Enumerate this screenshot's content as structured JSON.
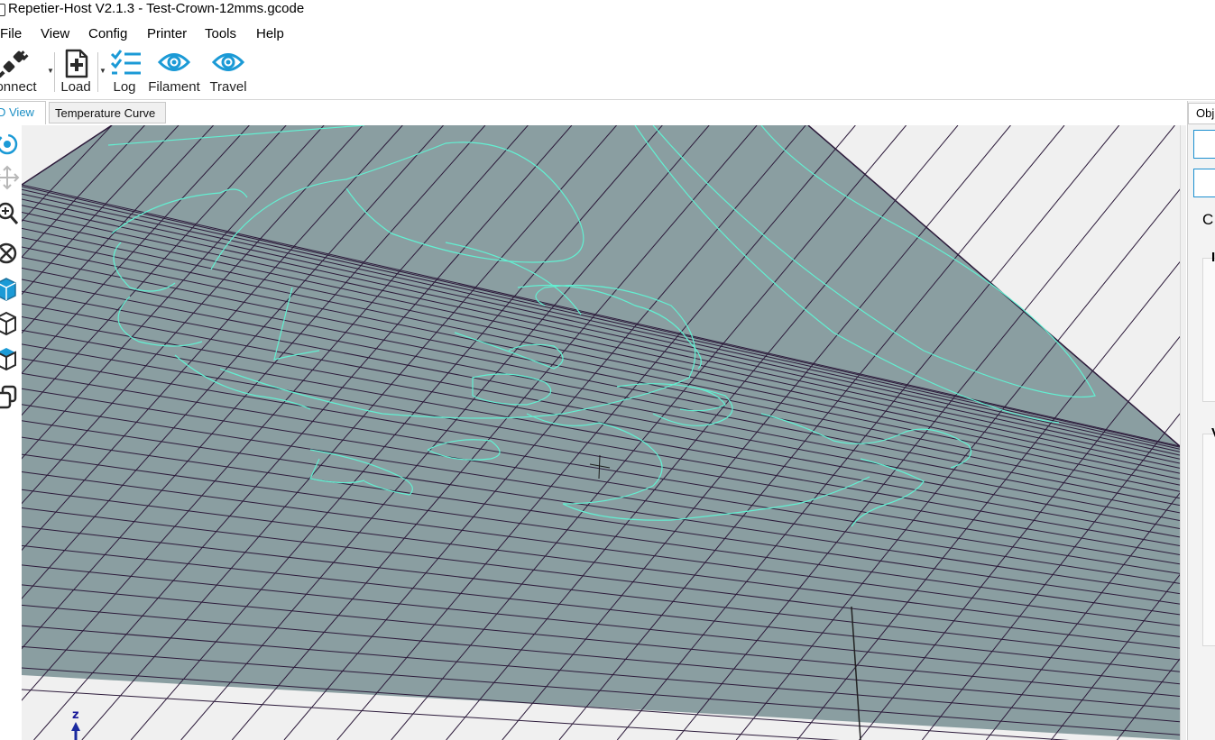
{
  "window": {
    "title": "Repetier-Host V2.1.3 - Test-Crown-12mms.gcode"
  },
  "menu": [
    "File",
    "View",
    "Config",
    "Printer",
    "Tools",
    "Help"
  ],
  "toolbar": {
    "connect_label": "onnect",
    "load_label": "Load",
    "log_label": "Log",
    "filament_label": "Filament",
    "travel_label": "Travel",
    "accent_color": "#1b9ad6"
  },
  "tabs": {
    "view3d": "D View",
    "temperature": "Temperature Curve"
  },
  "left_tools": [
    "rotate-icon",
    "move-icon",
    "zoom-icon",
    "reset-view-icon",
    "cube-front-icon",
    "cube-wire-icon",
    "cube-top-icon",
    "copy-icon"
  ],
  "viewport": {
    "axis_label": "z",
    "bed_color": "#8a9ea1",
    "grid_color": "#2c1a3a",
    "path_color": "#62f0d2"
  },
  "right_panel": {
    "tab_label": "Obj",
    "letter": "C",
    "group1_label": "I",
    "group2_label": "V"
  }
}
